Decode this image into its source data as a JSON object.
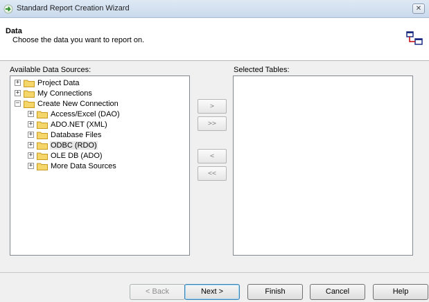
{
  "window": {
    "title": "Standard Report Creation Wizard"
  },
  "header": {
    "title": "Data",
    "subtitle": "Choose the data you want to report on."
  },
  "panels": {
    "available_label": "Available Data Sources:",
    "selected_label": "Selected Tables:"
  },
  "tree": {
    "items": [
      {
        "label": "Project Data",
        "expander": "+"
      },
      {
        "label": "My Connections",
        "expander": "+"
      },
      {
        "label": "Create New Connection",
        "expander": "−"
      },
      {
        "label": "Access/Excel (DAO)",
        "expander": "+"
      },
      {
        "label": "ADO.NET (XML)",
        "expander": "+"
      },
      {
        "label": "Database Files",
        "expander": "+"
      },
      {
        "label": "ODBC (RDO)",
        "expander": "+",
        "selected": true
      },
      {
        "label": "OLE DB (ADO)",
        "expander": "+"
      },
      {
        "label": "More Data Sources",
        "expander": "+"
      }
    ]
  },
  "transfer_buttons": {
    "add": ">",
    "add_all": ">>",
    "remove": "<",
    "remove_all": "<<"
  },
  "footer": {
    "back": "< Back",
    "next": "Next >",
    "finish": "Finish",
    "cancel": "Cancel",
    "help": "Help"
  },
  "colors": {
    "folder": "#f5d66b",
    "folder_border": "#c79a1d",
    "selection": "#e6e6e6"
  },
  "icons": {
    "title": "wizard-arrow-icon",
    "header": "tables-link-icon",
    "close": "close-icon",
    "folder": "folder-icon"
  }
}
